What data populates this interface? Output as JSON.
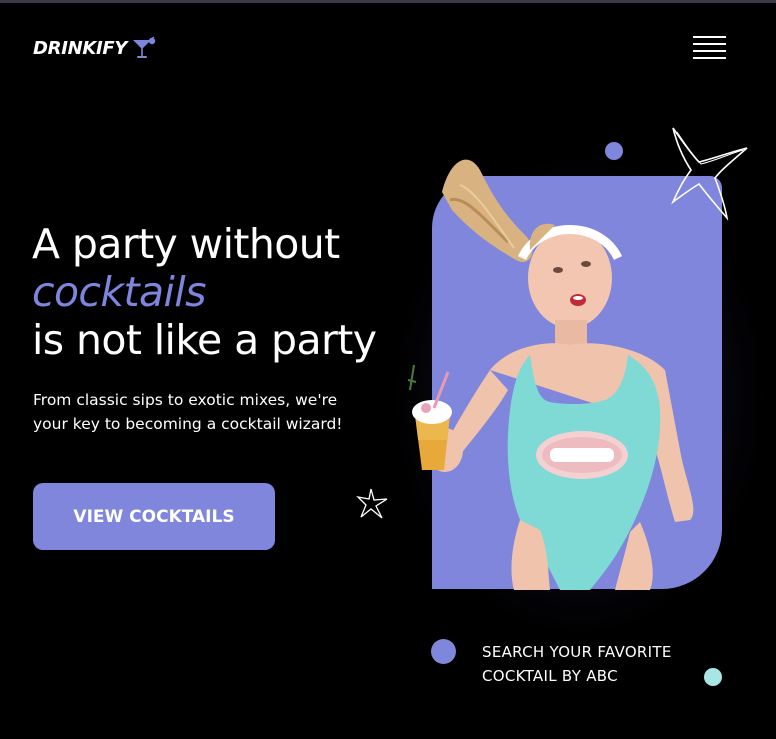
{
  "brand": {
    "name": "DRINKIFY",
    "logo_icon": "cocktail-glass-icon",
    "accent_color": "#7f86dc",
    "mint_color": "#a8e6e4"
  },
  "nav": {
    "menu_icon": "hamburger-menu-icon"
  },
  "hero": {
    "title_line1": "A party without",
    "title_accent": "cocktails",
    "title_line3": "is not like a party",
    "subtitle": "From classic sips to exotic mixes, we're your key to becoming a cocktail wizard!",
    "cta_label": "VIEW COCKTAILS",
    "image_alt": "woman in a mint swimsuit holding a cocktail"
  },
  "search_prompt": {
    "line1": "SEARCH YOUR FAVORITE",
    "line2": "COCKTAIL BY ABC"
  }
}
